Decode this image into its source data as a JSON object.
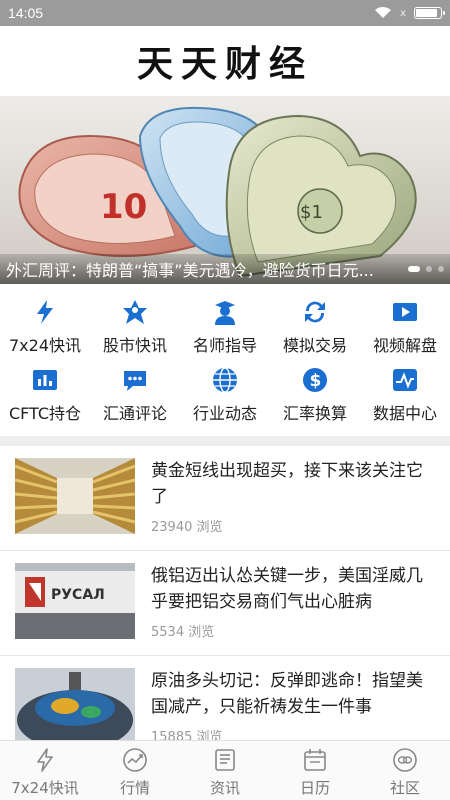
{
  "status_bar": {
    "time": "14:05",
    "signal_text": "x"
  },
  "header": {
    "title": "天天财经"
  },
  "banner": {
    "caption": "外汇周评：特朗普“搞事”美元遇冷，避险货币日元...",
    "slide_count": 4,
    "active_slide": 1
  },
  "quick_menu": [
    {
      "label": "7x24快讯",
      "icon": "lightning-icon"
    },
    {
      "label": "股市快讯",
      "icon": "stock-figure-icon"
    },
    {
      "label": "名师指导",
      "icon": "teacher-icon"
    },
    {
      "label": "模拟交易",
      "icon": "exchange-arrows-icon"
    },
    {
      "label": "视频解盘",
      "icon": "video-play-icon"
    },
    {
      "label": "CFTC持仓",
      "icon": "bar-chart-icon"
    },
    {
      "label": "汇通评论",
      "icon": "comment-bubble-icon"
    },
    {
      "label": "行业动态",
      "icon": "globe-icon"
    },
    {
      "label": "汇率换算",
      "icon": "dollar-coin-icon"
    },
    {
      "label": "数据中心",
      "icon": "pulse-chart-icon"
    }
  ],
  "news": [
    {
      "title": "黄金短线出现超买，接下来该关注它了",
      "views": "23940 浏览",
      "thumb": "gold-bars"
    },
    {
      "title": "俄铝迈出认怂关键一步，美国淫威几乎要把铝交易商们气出心脏病",
      "views": "5534 浏览",
      "thumb": "rusal-sign"
    },
    {
      "title": "原油多头切记：反弹即逃命！指望美国减产，只能祈祷发生一件事",
      "views": "15885 浏览",
      "thumb": "oil-drum"
    }
  ],
  "bottom_nav": [
    {
      "label": "7x24快讯",
      "icon": "lightning-outline-icon"
    },
    {
      "label": "行情",
      "icon": "trend-circle-icon"
    },
    {
      "label": "资讯",
      "icon": "newspaper-icon"
    },
    {
      "label": "日历",
      "icon": "calendar-icon"
    },
    {
      "label": "社区",
      "icon": "chat-bubbles-icon"
    }
  ],
  "colors": {
    "accent_blue": "#1a6fd1",
    "status_bar": "#9b9b9b",
    "nav_gray": "#777777"
  }
}
